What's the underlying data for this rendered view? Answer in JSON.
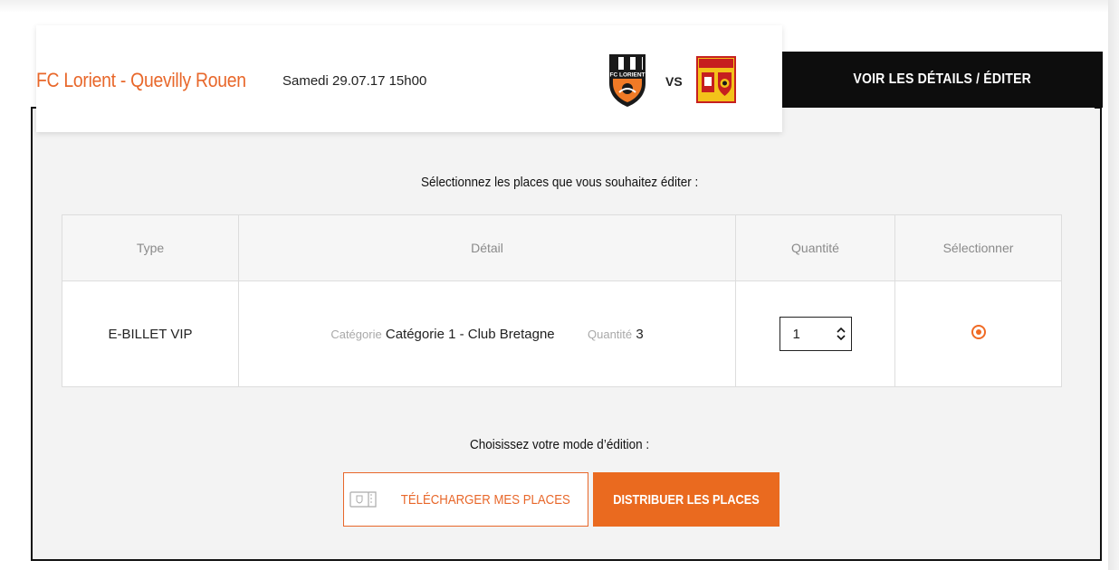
{
  "match": {
    "title": "FC Lorient - Quevilly Rouen",
    "date": "Samedi 29.07.17 15h00",
    "vs": "VS",
    "home_crest_text": "FC LORIENT"
  },
  "details_button": "VOIR LES DÉTAILS / ÉDITER",
  "select_prompt": "Sélectionnez les places que vous souhaitez éditer :",
  "table": {
    "headers": [
      "Type",
      "Détail",
      "Quantité",
      "Sélectionner"
    ],
    "rows": [
      {
        "type": "E-BILLET VIP",
        "category_label": "Catégorie",
        "category_value": "Catégorie 1 - Club Bretagne",
        "quantity_label": "Quantité",
        "quantity_value": "3",
        "quantity_input": "1",
        "selected": true
      }
    ]
  },
  "mode_prompt": "Choisissez votre mode d’édition :",
  "buttons": {
    "download": "TÉLÉCHARGER MES PLACES",
    "distribute": "DISTRIBUER LES PLACES"
  },
  "colors": {
    "accent": "#e8672a",
    "dark": "#0d0d0d"
  },
  "icons": {
    "home_crest": "fc-lorient-crest-icon",
    "away_crest": "quevilly-rouen-crest-icon",
    "ticket": "ticket-icon",
    "spin_up": "chevron-up-icon",
    "spin_down": "chevron-down-icon"
  }
}
